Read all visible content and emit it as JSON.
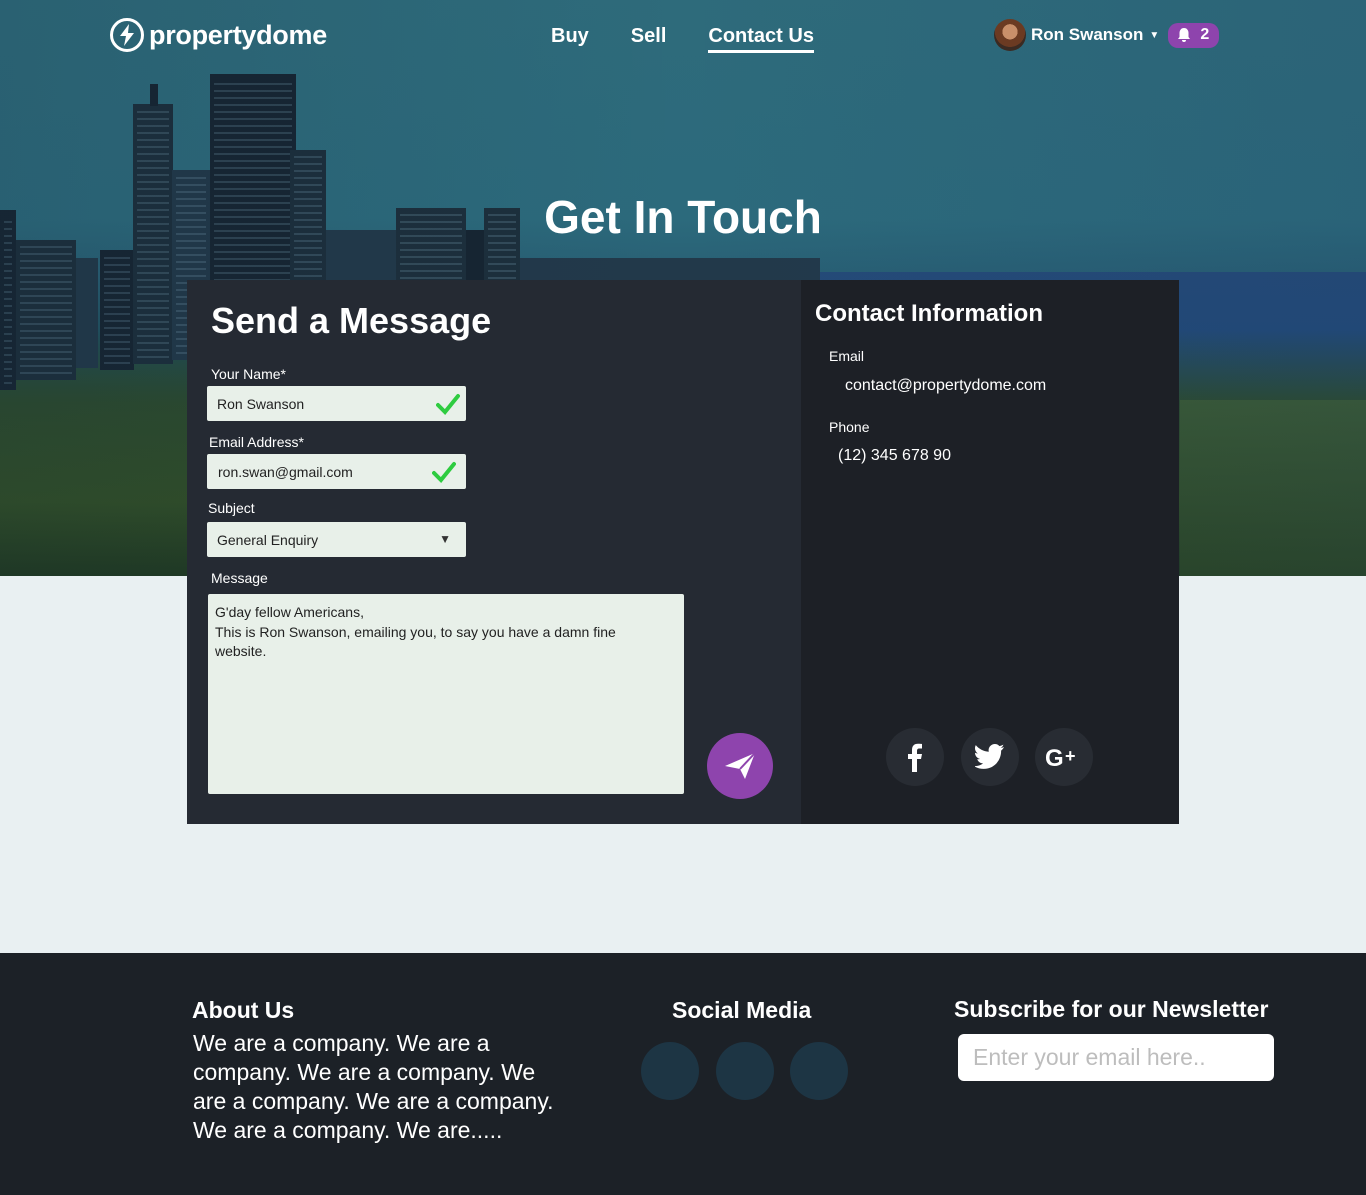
{
  "nav": {
    "logo_text": "propertydome",
    "links": [
      "Buy",
      "Sell",
      "Contact Us"
    ],
    "active_link": "Contact Us",
    "user_name": "Ron Swanson",
    "notification_count": "2"
  },
  "hero": {
    "title": "Get In Touch"
  },
  "form": {
    "title": "Send a Message",
    "name_label": "Your Name*",
    "name_value": "Ron Swanson",
    "email_label": "Email Address*",
    "email_value": "ron.swan@gmail.com",
    "subject_label": "Subject",
    "subject_value": "General Enquiry",
    "message_label": "Message",
    "message_value": "G'day fellow Americans,\nThis is Ron Swanson, emailing you, to say you have a damn fine\nwebsite."
  },
  "contact": {
    "title": "Contact Information",
    "email_label": "Email",
    "email_value": "contact@propertydome.com",
    "phone_label": "Phone",
    "phone_value": "(12) 345 678 90",
    "social": [
      "facebook-icon",
      "twitter-icon",
      "google-plus-icon"
    ]
  },
  "footer": {
    "about_title": "About Us",
    "about_text": "We are a company. We are a company. We are a company. We are a company. We are a company. We are a company. We are.....",
    "social_title": "Social Media",
    "newsletter_title": "Subscribe for our Newsletter",
    "newsletter_placeholder": "Enter your email here.."
  },
  "colors": {
    "accent": "#8e44ad",
    "check": "#2ecc40",
    "card_left": "#252a33",
    "card_right": "#1d2026",
    "footer": "#1c2127"
  }
}
